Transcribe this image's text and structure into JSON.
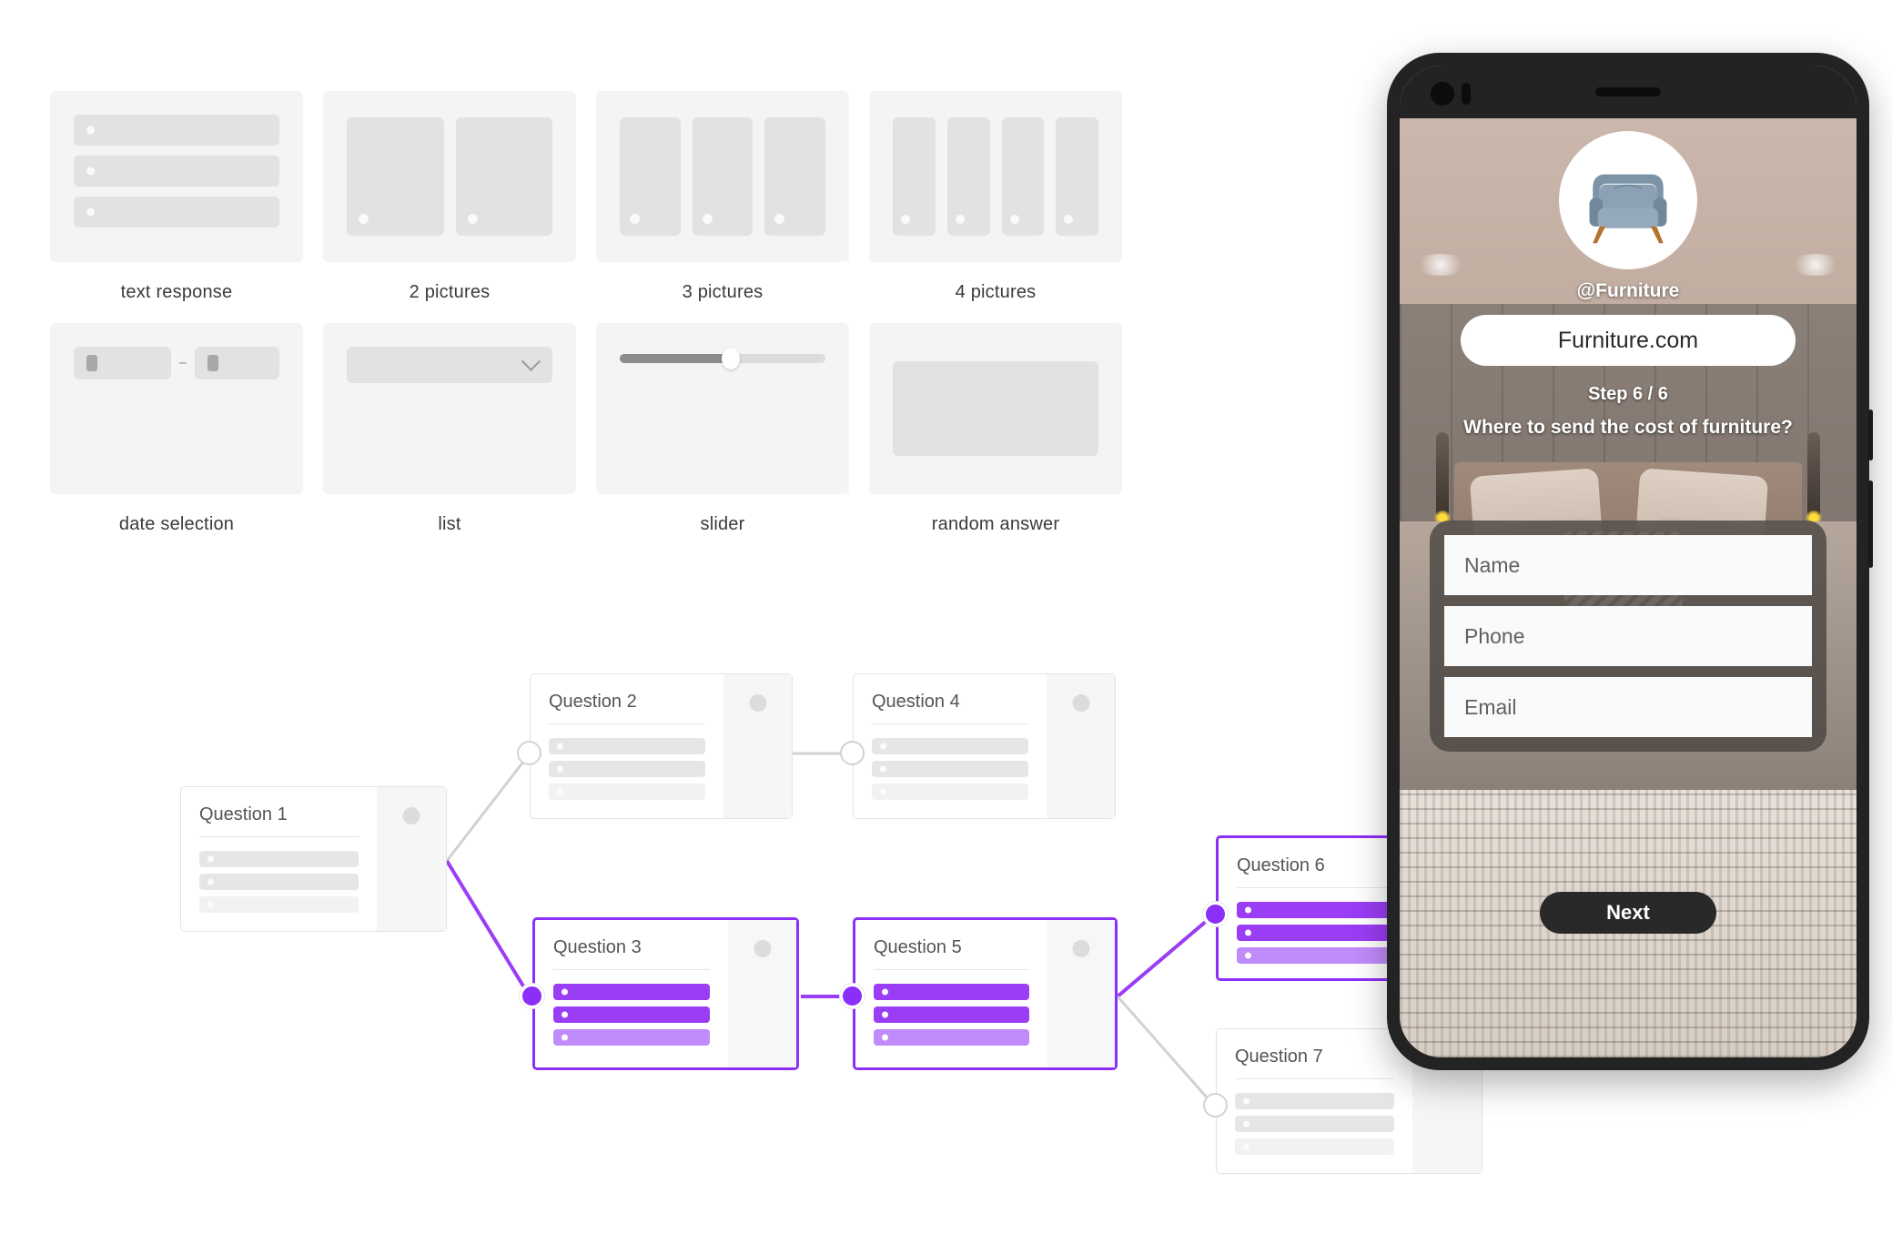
{
  "gallery": {
    "row1": [
      {
        "label": "text response",
        "type": "text-response"
      },
      {
        "label": "2 pictures",
        "type": "pictures-2"
      },
      {
        "label": "3 pictures",
        "type": "pictures-3"
      },
      {
        "label": "4 pictures",
        "type": "pictures-4"
      }
    ],
    "row2": [
      {
        "label": "date selection",
        "type": "date-selection"
      },
      {
        "label": "list",
        "type": "list"
      },
      {
        "label": "slider",
        "type": "slider"
      },
      {
        "label": "random answer",
        "type": "random-answer"
      }
    ],
    "slider_value_percent": 54
  },
  "flow": {
    "accent_color": "#8b2ff8",
    "accent_light_color": "#c08bfa",
    "inactive_color": "#e6e6e6",
    "nodes": [
      {
        "id": "q1",
        "title": "Question 1",
        "active": false,
        "options": [
          "normal",
          "normal",
          "faint"
        ]
      },
      {
        "id": "q2",
        "title": "Question 2",
        "active": false,
        "options": [
          "normal",
          "normal",
          "faint"
        ]
      },
      {
        "id": "q3",
        "title": "Question 3",
        "active": true,
        "options": [
          "purple",
          "purple",
          "purple-light"
        ]
      },
      {
        "id": "q4",
        "title": "Question 4",
        "active": false,
        "options": [
          "normal",
          "normal",
          "faint"
        ]
      },
      {
        "id": "q5",
        "title": "Question 5",
        "active": true,
        "options": [
          "purple",
          "purple",
          "purple-light"
        ]
      },
      {
        "id": "q6",
        "title": "Question 6",
        "active": true,
        "options": [
          "purple",
          "purple",
          "purple-light"
        ]
      },
      {
        "id": "q7",
        "title": "Question 7",
        "active": false,
        "options": [
          "normal",
          "normal",
          "faint"
        ]
      }
    ],
    "connections": [
      {
        "from": "q1",
        "to": "q2",
        "active": false
      },
      {
        "from": "q2",
        "to": "q4",
        "active": false
      },
      {
        "from": "q1",
        "to": "q3",
        "active": true
      },
      {
        "from": "q3",
        "to": "q5",
        "active": true
      },
      {
        "from": "q5",
        "to": "q6",
        "active": true
      },
      {
        "from": "q5",
        "to": "q7",
        "active": false
      }
    ]
  },
  "phone": {
    "handle": "@Furniture",
    "brand": "Furniture.com",
    "step": "Step 6 / 6",
    "question": "Where to send the cost of furniture?",
    "fields": [
      {
        "name": "name",
        "placeholder": "Name"
      },
      {
        "name": "phone",
        "placeholder": "Phone"
      },
      {
        "name": "email",
        "placeholder": "Email"
      }
    ],
    "next_label": "Next"
  }
}
